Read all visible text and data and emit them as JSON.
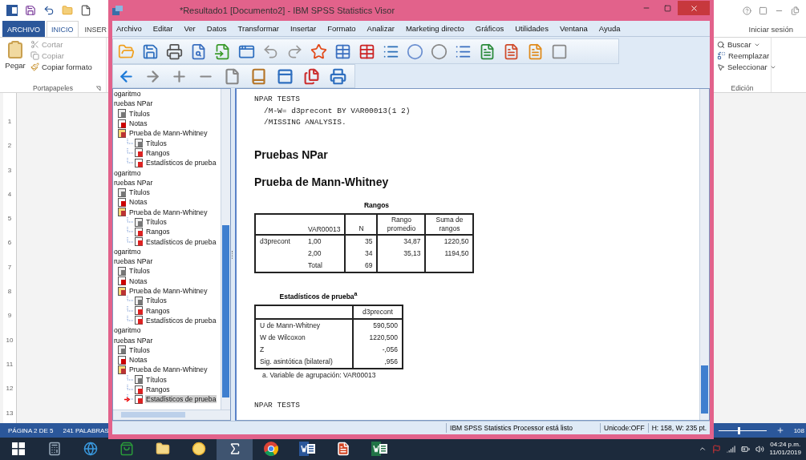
{
  "word": {
    "tabs": [
      {
        "label": "ARCHIVO",
        "kind": "file",
        "selected": false
      },
      {
        "label": "INICIO",
        "kind": "tab",
        "selected": true
      },
      {
        "label": "INSER",
        "kind": "tab",
        "selected": false
      }
    ],
    "sign_in": "Iniciar sesión",
    "clipboard": {
      "paste": "Pegar",
      "cut": "Cortar",
      "copy": "Copiar",
      "format_painter": "Copiar formato",
      "group": "Portapapeles"
    },
    "editing": {
      "find": "Buscar",
      "replace": "Reemplazar",
      "select": "Seleccionar",
      "group": "Edición"
    },
    "ruler_numbers": [
      "1",
      "2",
      "3",
      "4",
      "5",
      "6",
      "7",
      "8",
      "9",
      "10",
      "11",
      "12",
      "13"
    ],
    "status_bar": {
      "page": "PÁGINA 2 DE 5",
      "words": "241 PALABRAS",
      "zoom": {
        "level": 0.4,
        "reading": "108"
      }
    }
  },
  "spss": {
    "title": "*Resultado1 [Documento2] - IBM SPSS Statistics Visor",
    "menu": [
      "Archivo",
      "Editar",
      "Ver",
      "Datos",
      "Transformar",
      "Insertar",
      "Formato",
      "Analizar",
      "Marketing directo",
      "Gráficos",
      "Utilidades",
      "Ventana",
      "Ayuda"
    ],
    "tree": [
      {
        "label": "ogaritmo",
        "selected": false
      },
      {
        "label": "ruebas NPar",
        "selected": false,
        "children": [
          {
            "label": "Títulos",
            "kind": "title",
            "selected": false
          },
          {
            "label": "Notas",
            "kind": "notes",
            "selected": false
          },
          {
            "label": "Prueba de Mann-Whitney",
            "kind": "procedure",
            "selected": false,
            "children": [
              {
                "label": "Títulos",
                "kind": "title",
                "selected": false
              },
              {
                "label": "Rangos",
                "kind": "table",
                "selected": false
              },
              {
                "label": "Estadísticos de prueba",
                "kind": "table",
                "selected": false
              }
            ]
          }
        ]
      },
      {
        "label": "ogaritmo",
        "selected": false
      },
      {
        "label": "ruebas NPar",
        "selected": false,
        "children": [
          {
            "label": "Títulos",
            "kind": "title",
            "selected": false
          },
          {
            "label": "Notas",
            "kind": "notes",
            "selected": false
          },
          {
            "label": "Prueba de Mann-Whitney",
            "kind": "procedure",
            "selected": false,
            "children": [
              {
                "label": "Títulos",
                "kind": "title",
                "selected": false
              },
              {
                "label": "Rangos",
                "kind": "table",
                "selected": false
              },
              {
                "label": "Estadísticos de prueba",
                "kind": "table",
                "selected": false
              }
            ]
          }
        ]
      },
      {
        "label": "ogaritmo",
        "selected": false
      },
      {
        "label": "ruebas NPar",
        "selected": false,
        "children": [
          {
            "label": "Títulos",
            "kind": "title",
            "selected": false
          },
          {
            "label": "Notas",
            "kind": "notes",
            "selected": false
          },
          {
            "label": "Prueba de Mann-Whitney",
            "kind": "procedure",
            "selected": false,
            "children": [
              {
                "label": "Títulos",
                "kind": "title",
                "selected": false
              },
              {
                "label": "Rangos",
                "kind": "table",
                "selected": false
              },
              {
                "label": "Estadísticos de prueba",
                "kind": "table",
                "selected": false
              }
            ]
          }
        ]
      },
      {
        "label": "ogaritmo",
        "selected": false
      },
      {
        "label": "ruebas NPar",
        "selected": false,
        "children": [
          {
            "label": "Títulos",
            "kind": "title",
            "selected": false
          },
          {
            "label": "Notas",
            "kind": "notes",
            "selected": false
          },
          {
            "label": "Prueba de Mann-Whitney",
            "kind": "procedure",
            "selected": false,
            "children": [
              {
                "label": "Títulos",
                "kind": "title",
                "selected": false
              },
              {
                "label": "Rangos",
                "kind": "table",
                "selected": false
              },
              {
                "label": "Estadísticos de prueba",
                "kind": "table",
                "selected": true
              }
            ]
          }
        ]
      }
    ],
    "output": {
      "syntax_top": [
        "NPAR TESTS",
        "/M-W= d3precont BY VAR00013(1 2)",
        "/MISSING ANALYSIS."
      ],
      "heading": "Pruebas NPar",
      "subheading": "Prueba de Mann-Whitney",
      "ranks_table": {
        "title": "Rangos",
        "row_header": "VAR00013",
        "columns": [
          "N",
          "Rango promedio",
          "Suma de rangos"
        ],
        "rows": [
          {
            "group": "d3precont",
            "label": "1,00",
            "values": [
              "35",
              "34,87",
              "1220,50"
            ]
          },
          {
            "label": "2,00",
            "values": [
              "34",
              "35,13",
              "1194,50"
            ]
          },
          {
            "label": "Total",
            "values": [
              "69"
            ]
          }
        ]
      },
      "stats_table": {
        "title": "Estadísticos de prueba$^{a}$",
        "column": "d3precont",
        "rows": [
          {
            "label": "U de Mann-Whitney",
            "value": "590,500"
          },
          {
            "label": "W de Wilcoxon",
            "value": "1220,500"
          },
          {
            "label": "Z",
            "value": "-,056"
          },
          {
            "label": "Sig. asintótica (bilateral)",
            "value": ",956"
          }
        ],
        "footnote": "a. Variable de agrupación: VAR00013"
      },
      "syntax_bottom": [
        "NPAR TESTS"
      ]
    },
    "status_bar": {
      "message": "IBM SPSS Statistics Processor está listo",
      "unicode": "Unicode:OFF",
      "size": "H: 158, W: 235 pt."
    }
  },
  "taskbar": {
    "time": "04:24 p.m.",
    "date": "11/01/2019"
  }
}
